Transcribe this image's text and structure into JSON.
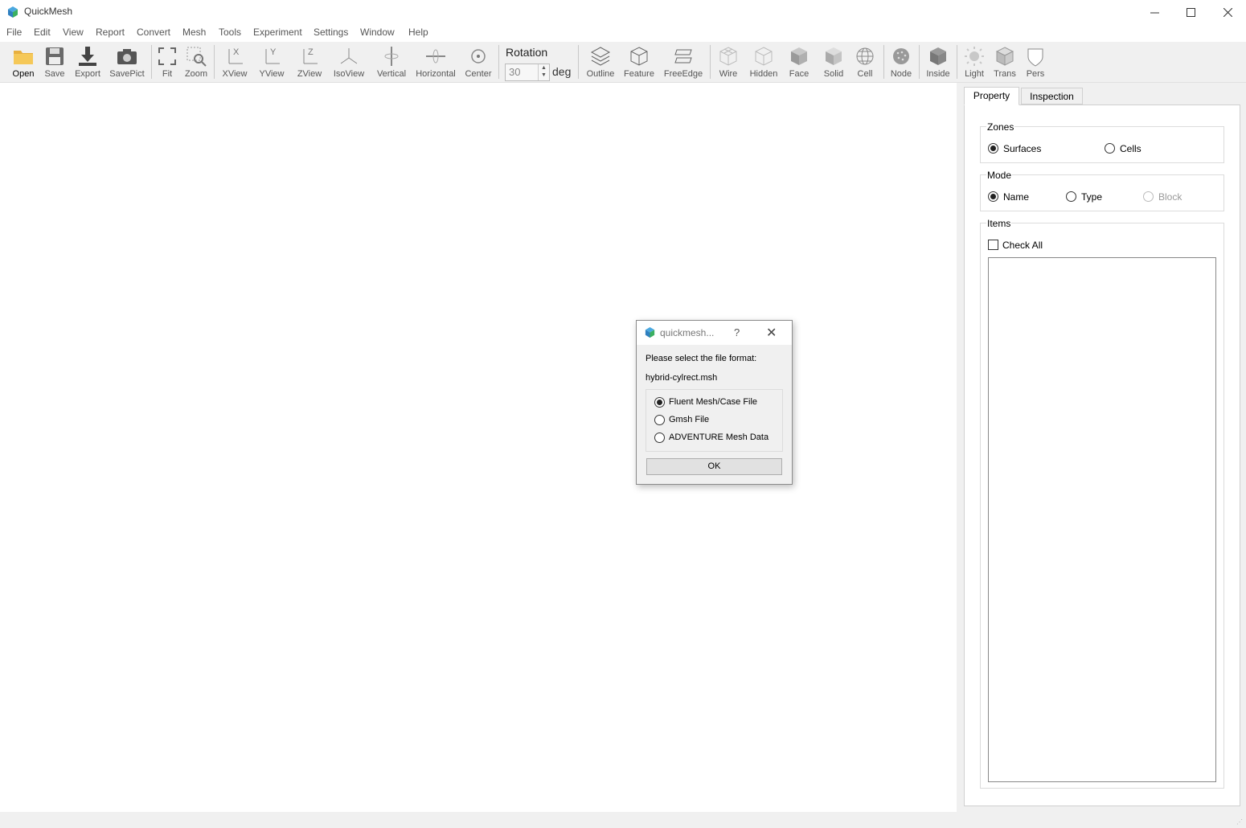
{
  "window": {
    "title": "QuickMesh",
    "minimize_icon": "minimize-icon",
    "maximize_icon": "maximize-icon",
    "close_icon": "close-icon"
  },
  "menu": [
    "File",
    "Edit",
    "View",
    "Report",
    "Convert",
    "Mesh",
    "Tools",
    "Experiment",
    "Settings",
    "Window",
    "Help"
  ],
  "toolbar": {
    "open": "Open",
    "save": "Save",
    "export": "Export",
    "savepict": "SavePict",
    "fit": "Fit",
    "zoom": "Zoom",
    "xview": "XView",
    "yview": "YView",
    "zview": "ZView",
    "isoview": "IsoView",
    "vertical": "Vertical",
    "horizontal": "Horizontal",
    "center": "Center",
    "rotation_label": "Rotation",
    "rotation_value": "30",
    "rotation_unit": "deg",
    "outline": "Outline",
    "feature": "Feature",
    "freeedge": "FreeEdge",
    "wire": "Wire",
    "hidden": "Hidden",
    "face": "Face",
    "solid": "Solid",
    "cell": "Cell",
    "node": "Node",
    "inside": "Inside",
    "light": "Light",
    "trans": "Trans",
    "pers": "Pers"
  },
  "panel": {
    "tabs": [
      "Property",
      "Inspection"
    ],
    "zones": {
      "title": "Zones",
      "surfaces": "Surfaces",
      "cells": "Cells",
      "selected": "Surfaces"
    },
    "mode": {
      "title": "Mode",
      "name": "Name",
      "type": "Type",
      "block": "Block",
      "selected": "Name"
    },
    "items": {
      "title": "Items",
      "check_all": "Check All",
      "checked": false
    }
  },
  "dialog": {
    "title": "quickmesh...",
    "help": "?",
    "prompt": "Please select the file format:",
    "filename": "hybrid-cylrect.msh",
    "options": [
      "Fluent Mesh/Case File",
      "Gmsh File",
      "ADVENTURE Mesh Data"
    ],
    "selected": "Fluent Mesh/Case File",
    "ok": "OK"
  },
  "colors": {
    "accent_blue": "#2a7fd4",
    "accent_green": "#3aa655",
    "toolbar_bg": "#f0f0f0"
  }
}
